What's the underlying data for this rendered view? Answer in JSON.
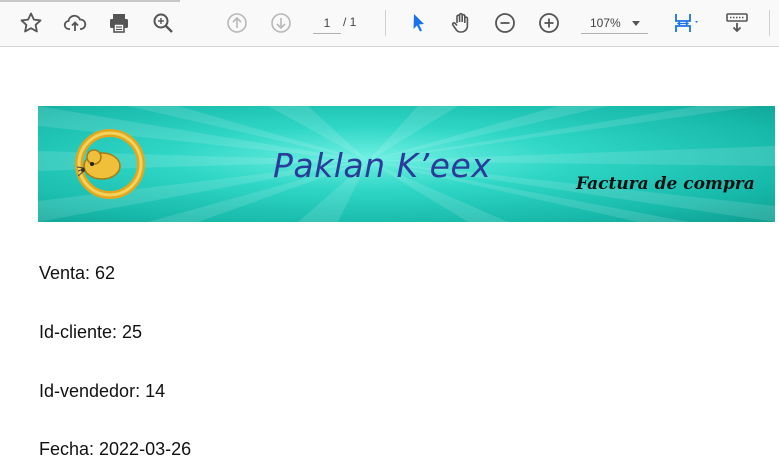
{
  "toolbar": {
    "page_current": "1",
    "page_total": "/ 1",
    "zoom": "107%",
    "icons": [
      "star-icon",
      "cloud-upload-icon",
      "printer-icon",
      "search-icon",
      "arrow-up-icon",
      "arrow-down-icon",
      "select-cursor-icon",
      "hand-icon",
      "zoom-out-icon",
      "zoom-in-icon",
      "fit-page-icon",
      "more-tools-icon"
    ],
    "accent": "#1a73e8"
  },
  "document": {
    "banner_title": "Paklan K’eex",
    "banner_subtitle": "Factura de compra",
    "fields": [
      {
        "label": "Venta: 62"
      },
      {
        "label": "Id-cliente: 25"
      },
      {
        "label": "Id-vendedor: 14"
      },
      {
        "label": "Fecha: 2022-03-26"
      }
    ]
  }
}
